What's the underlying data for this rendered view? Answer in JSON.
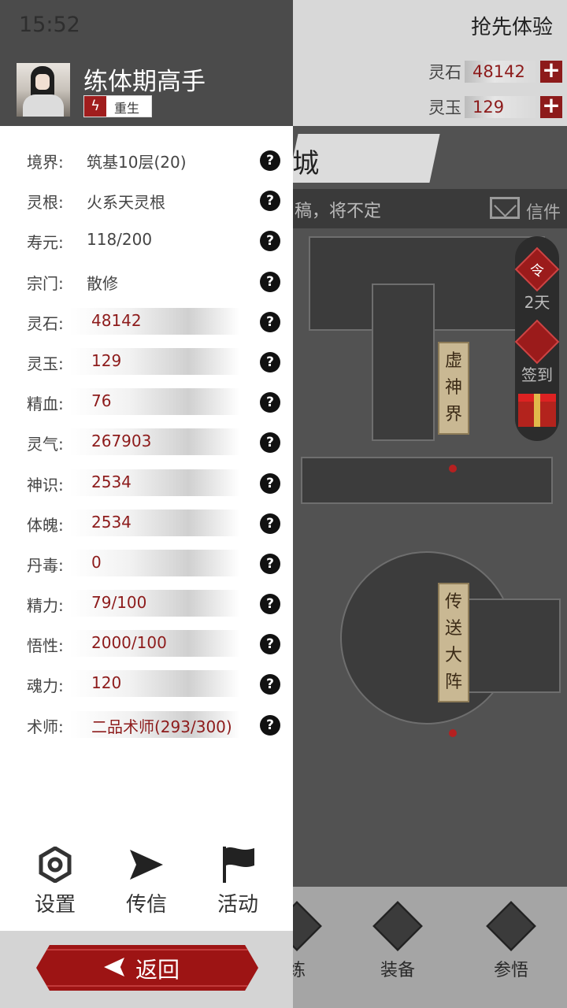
{
  "status_bar": {
    "time": "15:52"
  },
  "background": {
    "early_access": "抢先体验",
    "resources": [
      {
        "name": "灵石",
        "value": "48142"
      },
      {
        "name": "灵玉",
        "value": "129"
      }
    ],
    "city_name": "城",
    "news_text": "稿，将不定",
    "mail_label": "信件",
    "side_buttons": {
      "order_glyph": "令",
      "order_days": "2天",
      "signin_label": "签到"
    },
    "map_tags": [
      "虚神界",
      "传送大阵"
    ],
    "bottom_nav": [
      "练",
      "装备",
      "参悟"
    ]
  },
  "drawer": {
    "player": {
      "name": "练体期高手",
      "tag": "重生"
    },
    "stats": [
      {
        "label": "境界:",
        "value": "筑基10层(20)",
        "style": "plain"
      },
      {
        "label": "灵根:",
        "value": "火系天灵根",
        "style": "plain"
      },
      {
        "label": "寿元:",
        "value": "118/200",
        "style": "plain"
      },
      {
        "label": "宗门:",
        "value": "散修",
        "style": "plain"
      },
      {
        "label": "灵石:",
        "value": "48142",
        "style": "bar"
      },
      {
        "label": "灵玉:",
        "value": "129",
        "style": "bar"
      },
      {
        "label": "精血:",
        "value": "76",
        "style": "bar"
      },
      {
        "label": "灵气:",
        "value": "267903",
        "style": "bar"
      },
      {
        "label": "神识:",
        "value": "2534",
        "style": "bar"
      },
      {
        "label": "体魄:",
        "value": "2534",
        "style": "bar"
      },
      {
        "label": "丹毒:",
        "value": "0",
        "style": "bar"
      },
      {
        "label": "精力:",
        "value": "79/100",
        "style": "bar"
      },
      {
        "label": "悟性:",
        "value": "2000/100",
        "style": "bar"
      },
      {
        "label": "魂力:",
        "value": "120",
        "style": "bar"
      },
      {
        "label": "术师:",
        "value": "二品术师(293/300)",
        "style": "bar"
      }
    ],
    "help_glyph": "?",
    "menu": [
      {
        "label": "设置",
        "icon": "gear-icon"
      },
      {
        "label": "传信",
        "icon": "send-icon"
      },
      {
        "label": "活动",
        "icon": "flag-icon"
      }
    ],
    "return_label": "返回"
  },
  "colors": {
    "accent_red": "#9d1414",
    "value_red": "#8d1b1b",
    "header_gray": "#4b4b4b"
  }
}
